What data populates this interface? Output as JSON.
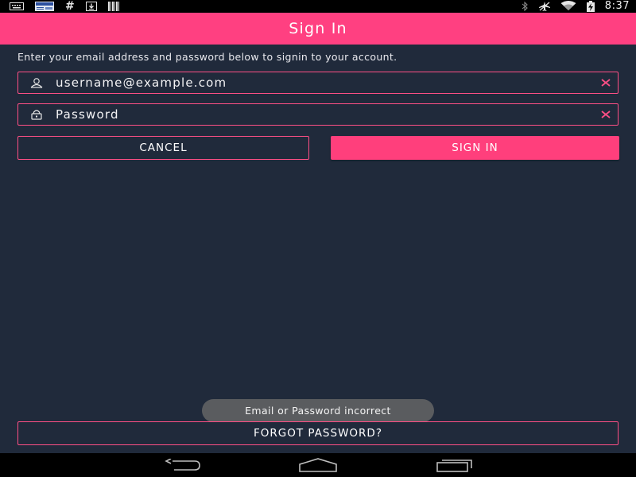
{
  "status_bar": {
    "left_icons": [
      "keyboard-icon",
      "news-icon",
      "hash-icon",
      "download-icon",
      "barcode-icon"
    ],
    "right_icons": [
      "bluetooth-icon",
      "airplane-mode-icon",
      "wifi-icon",
      "battery-charging-icon"
    ],
    "time": "8:37"
  },
  "app_bar": {
    "title": "Sign In",
    "color": "#ff4081"
  },
  "form": {
    "instructions": "Enter your email address and password below to signin to your account.",
    "email": {
      "value": "username@example.com",
      "icon": "user-icon",
      "clear_icon": "clear-icon"
    },
    "password": {
      "placeholder": "Password",
      "icon": "lock-icon",
      "clear_icon": "clear-icon"
    }
  },
  "buttons": {
    "cancel_label": "CANCEL",
    "signin_label": "SIGN IN",
    "forgot_label": "FORGOT PASSWORD?"
  },
  "toast": {
    "message": "Email or Password incorrect"
  },
  "nav_bar": {
    "icons": [
      "back-icon",
      "home-icon",
      "recents-icon"
    ]
  },
  "colors": {
    "background": "#202a3b",
    "accent": "#ff4081",
    "toast_bg": "#5a5c5f"
  }
}
